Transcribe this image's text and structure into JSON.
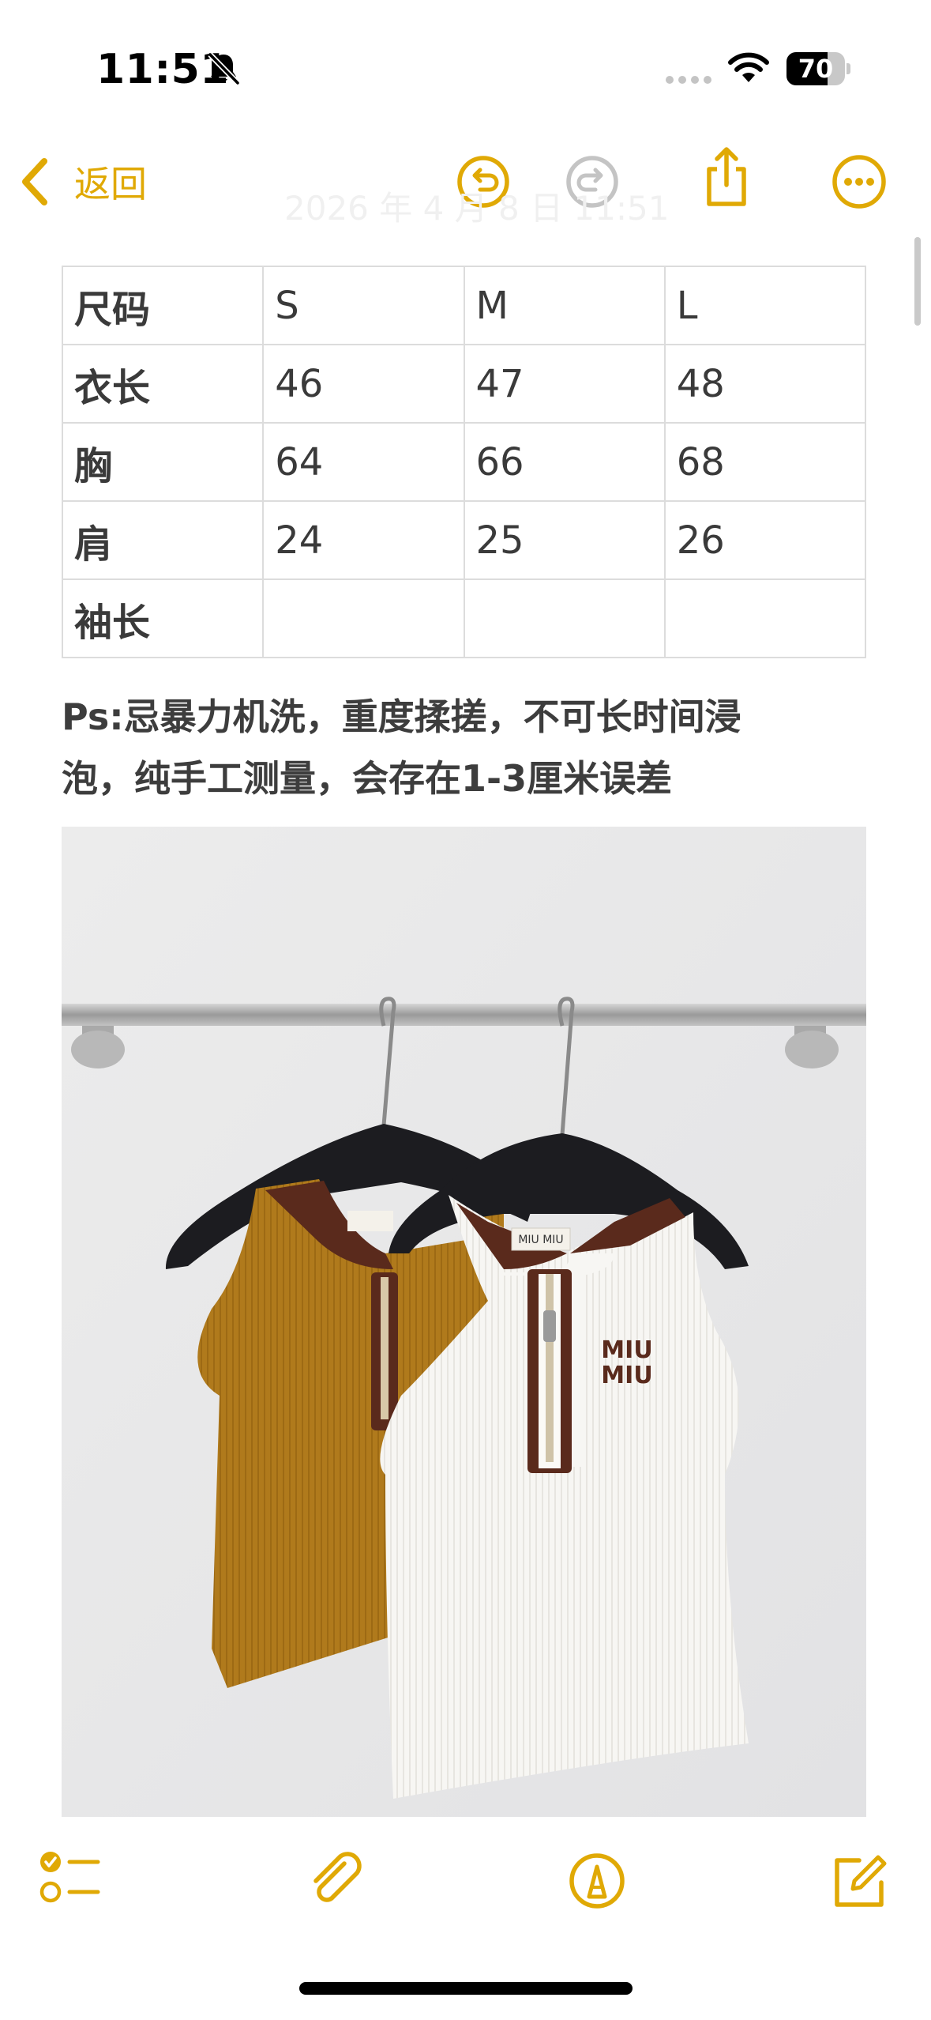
{
  "status_bar": {
    "time": "11:51",
    "battery_percent": "70",
    "battery_level": 0.7,
    "icons": [
      "bell-slash-icon",
      "cellular-dots-icon",
      "wifi-icon",
      "battery-icon"
    ]
  },
  "nav": {
    "back_label": "返回",
    "faded_date": "2026 年 4 月 8 日 11:51",
    "icons": [
      "chevron-left-icon",
      "undo-icon",
      "redo-icon",
      "share-icon",
      "ellipsis-icon"
    ]
  },
  "table": {
    "rows": [
      [
        "尺码",
        "S",
        "M",
        "L"
      ],
      [
        "衣长",
        "46",
        "47",
        "48"
      ],
      [
        "胸",
        "64",
        "66",
        "68"
      ],
      [
        "肩",
        "24",
        "25",
        "26"
      ],
      [
        "袖长",
        "",
        "",
        ""
      ]
    ]
  },
  "note": {
    "line1": "Ps:忌暴力机洗，重度揉搓，不可长时间浸",
    "line2": "泡，纯手工测量，会存在1-3厘米误差"
  },
  "photo": {
    "label_text": "MIU MIU",
    "logo_line1": "MIU",
    "logo_line2": "MIU"
  },
  "toolbar": {
    "icons": [
      "checklist-icon",
      "paperclip-icon",
      "markup-pen-icon",
      "compose-icon"
    ]
  },
  "colors": {
    "accent": "#e0a905",
    "disabled": "#c4c4c4",
    "text": "#3a3a3a",
    "table_border": "#dcdcdc",
    "mustard_top": "#b07a1c",
    "trim_brown": "#5a2a1c"
  }
}
